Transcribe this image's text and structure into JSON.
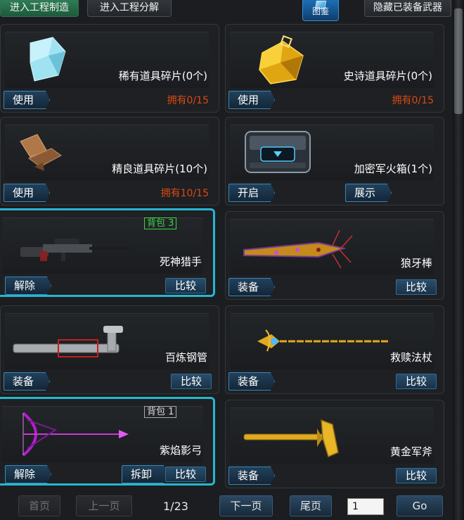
{
  "top": {
    "craft": "进入工程制造",
    "decompose": "进入工程分解",
    "codex": "图鉴",
    "hide": "隐藏已装备武器"
  },
  "cards": [
    {
      "name": "稀有道具碎片(0个)",
      "count": "拥有0/15",
      "left_btn": "使用",
      "icon": "cyan-shard-icon"
    },
    {
      "name": "史诗道具碎片(0个)",
      "count": "拥有0/15",
      "left_btn": "使用",
      "icon": "gold-shard-icon"
    },
    {
      "name": "精良道具碎片(10个)",
      "count": "拥有10/15",
      "left_btn": "使用",
      "icon": "brown-shard-icon"
    },
    {
      "name": "加密军火箱(1个)",
      "left_btn": "开启",
      "mid_btn": "展示",
      "icon": "crate-icon"
    },
    {
      "name": "死神猎手",
      "tag": "背包 3",
      "left_btn": "解除",
      "right_btn": "比较",
      "icon": "sniper-rifle-icon"
    },
    {
      "name": "狼牙棒",
      "left_btn": "装备",
      "right_btn": "比较",
      "icon": "spiked-bat-icon"
    },
    {
      "name": "百炼钢管",
      "left_btn": "装备",
      "right_btn": "比较",
      "icon": "steel-pipe-icon"
    },
    {
      "name": "救赎法杖",
      "left_btn": "装备",
      "right_btn": "比较",
      "icon": "staff-icon"
    },
    {
      "name": "紫焰影弓",
      "tag": "背包 1",
      "left_btn": "解除",
      "mid_btn": "拆卸",
      "right_btn": "比较",
      "icon": "purple-bow-icon"
    },
    {
      "name": "黄金军斧",
      "left_btn": "装备",
      "right_btn": "比较",
      "icon": "golden-axe-icon"
    }
  ],
  "pager": {
    "first": "首页",
    "prev": "上一页",
    "page": "1/23",
    "next": "下一页",
    "last": "尾页",
    "input_value": "1",
    "go": "Go"
  },
  "colors": {
    "highlight_border": "#27b6d0",
    "count_red": "#d84a12",
    "tag_green": "#3fd24a"
  }
}
